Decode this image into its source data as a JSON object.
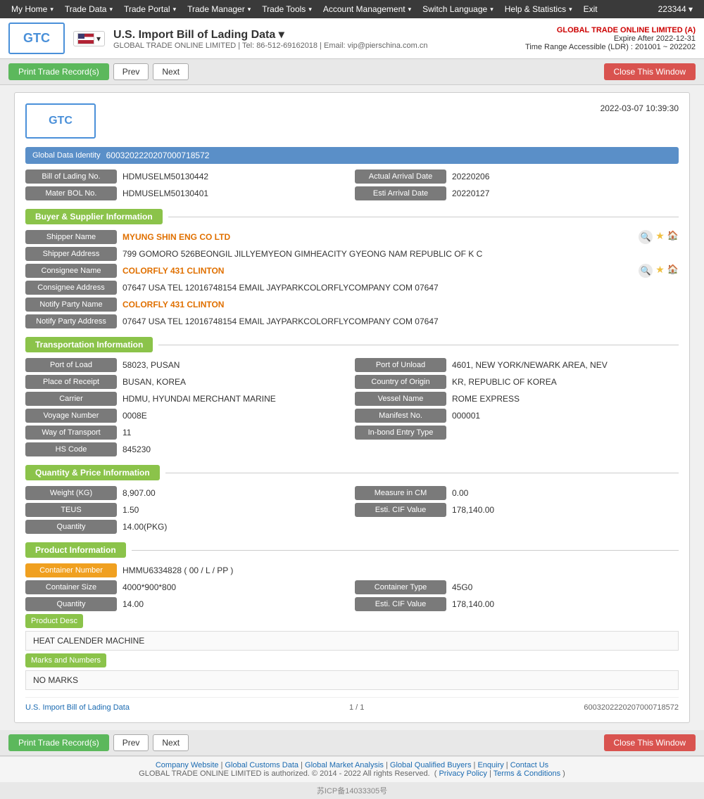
{
  "topnav": {
    "items": [
      "My Home",
      "Trade Data",
      "Trade Portal",
      "Trade Manager",
      "Trade Tools",
      "Account Management",
      "Switch Language",
      "Help & Statistics",
      "Exit"
    ],
    "user_id": "223344 ▾"
  },
  "header": {
    "logo_text": "GTC",
    "flag_alt": "US Flag",
    "title": "U.S. Import Bill of Lading Data ▾",
    "subtitle": "GLOBAL TRADE ONLINE LIMITED | Tel: 86-512-69162018 | Email: vip@pierschina.com.cn",
    "company": "GLOBAL TRADE ONLINE LIMITED (A)",
    "expire": "Expire After 2022-12-31",
    "time_range": "Time Range Accessible (LDR) : 201001 ~ 202202"
  },
  "toolbar": {
    "print_label": "Print Trade Record(s)",
    "prev_label": "Prev",
    "next_label": "Next",
    "close_label": "Close This Window"
  },
  "card": {
    "logo_text": "GTC",
    "date": "2022-03-07 10:39:30",
    "global_data_identity_label": "Global Data Identity",
    "global_data_identity_value": "6003202220207000718572",
    "bill_of_lading_label": "Bill of Lading No.",
    "bill_of_lading_value": "HDMUSELM50130442",
    "actual_arrival_label": "Actual Arrival Date",
    "actual_arrival_value": "20220206",
    "mater_bol_label": "Mater BOL No.",
    "mater_bol_value": "HDMUSELM50130401",
    "esti_arrival_label": "Esti Arrival Date",
    "esti_arrival_value": "20220127"
  },
  "buyer_supplier": {
    "section_title": "Buyer & Supplier Information",
    "shipper_name_label": "Shipper Name",
    "shipper_name_value": "MYUNG SHIN ENG CO LTD",
    "shipper_address_label": "Shipper Address",
    "shipper_address_value": "799 GOMORO 526BEONGIL JILLYEMYEON GIMHEACITY GYEONG NAM REPUBLIC OF K C",
    "consignee_name_label": "Consignee Name",
    "consignee_name_value": "COLORFLY 431 CLINTON",
    "consignee_address_label": "Consignee Address",
    "consignee_address_value": "07647 USA TEL 12016748154 EMAIL JAYPARKCOLORFLYCOMPANY COM 07647",
    "notify_party_name_label": "Notify Party Name",
    "notify_party_name_value": "COLORFLY 431 CLINTON",
    "notify_party_address_label": "Notify Party Address",
    "notify_party_address_value": "07647 USA TEL 12016748154 EMAIL JAYPARKCOLORFLYCOMPANY COM 07647"
  },
  "transportation": {
    "section_title": "Transportation Information",
    "port_of_load_label": "Port of Load",
    "port_of_load_value": "58023, PUSAN",
    "port_of_unload_label": "Port of Unload",
    "port_of_unload_value": "4601, NEW YORK/NEWARK AREA, NEV",
    "place_of_receipt_label": "Place of Receipt",
    "place_of_receipt_value": "BUSAN, KOREA",
    "country_of_origin_label": "Country of Origin",
    "country_of_origin_value": "KR, REPUBLIC OF KOREA",
    "carrier_label": "Carrier",
    "carrier_value": "HDMU, HYUNDAI MERCHANT MARINE",
    "vessel_name_label": "Vessel Name",
    "vessel_name_value": "ROME EXPRESS",
    "voyage_number_label": "Voyage Number",
    "voyage_number_value": "0008E",
    "manifest_no_label": "Manifest No.",
    "manifest_no_value": "000001",
    "way_of_transport_label": "Way of Transport",
    "way_of_transport_value": "11",
    "in_bond_label": "In-bond Entry Type",
    "in_bond_value": "",
    "hs_code_label": "HS Code",
    "hs_code_value": "845230"
  },
  "quantity_price": {
    "section_title": "Quantity & Price Information",
    "weight_label": "Weight (KG)",
    "weight_value": "8,907.00",
    "measure_label": "Measure in CM",
    "measure_value": "0.00",
    "teus_label": "TEUS",
    "teus_value": "1.50",
    "esti_cif_label": "Esti. CIF Value",
    "esti_cif_value": "178,140.00",
    "quantity_label": "Quantity",
    "quantity_value": "14.00(PKG)"
  },
  "product_info": {
    "section_title": "Product Information",
    "container_number_label": "Container Number",
    "container_number_value": "HMMU6334828 ( 00 / L / PP )",
    "container_size_label": "Container Size",
    "container_size_value": "4000*900*800",
    "container_type_label": "Container Type",
    "container_type_value": "45G0",
    "quantity_label": "Quantity",
    "quantity_value": "14.00",
    "esti_cif_label": "Esti. CIF Value",
    "esti_cif_value": "178,140.00",
    "product_desc_label": "Product Desc",
    "product_desc_value": "HEAT CALENDER MACHINE",
    "marks_label": "Marks and Numbers",
    "marks_value": "NO MARKS"
  },
  "card_footer": {
    "left_link": "U.S. Import Bill of Lading Data",
    "page_info": "1 / 1",
    "right_value": "6003202220207000718572"
  },
  "footer": {
    "links": [
      "Company Website",
      "Global Customs Data",
      "Global Market Analysis",
      "Global Qualified Buyers",
      "Enquiry",
      "Contact Us"
    ],
    "copyright": "GLOBAL TRADE ONLINE LIMITED is authorized. © 2014 - 2022 All rights Reserved.",
    "privacy": "Privacy Policy",
    "terms": "Terms & Conditions",
    "icp": "苏ICP备14033305号"
  }
}
